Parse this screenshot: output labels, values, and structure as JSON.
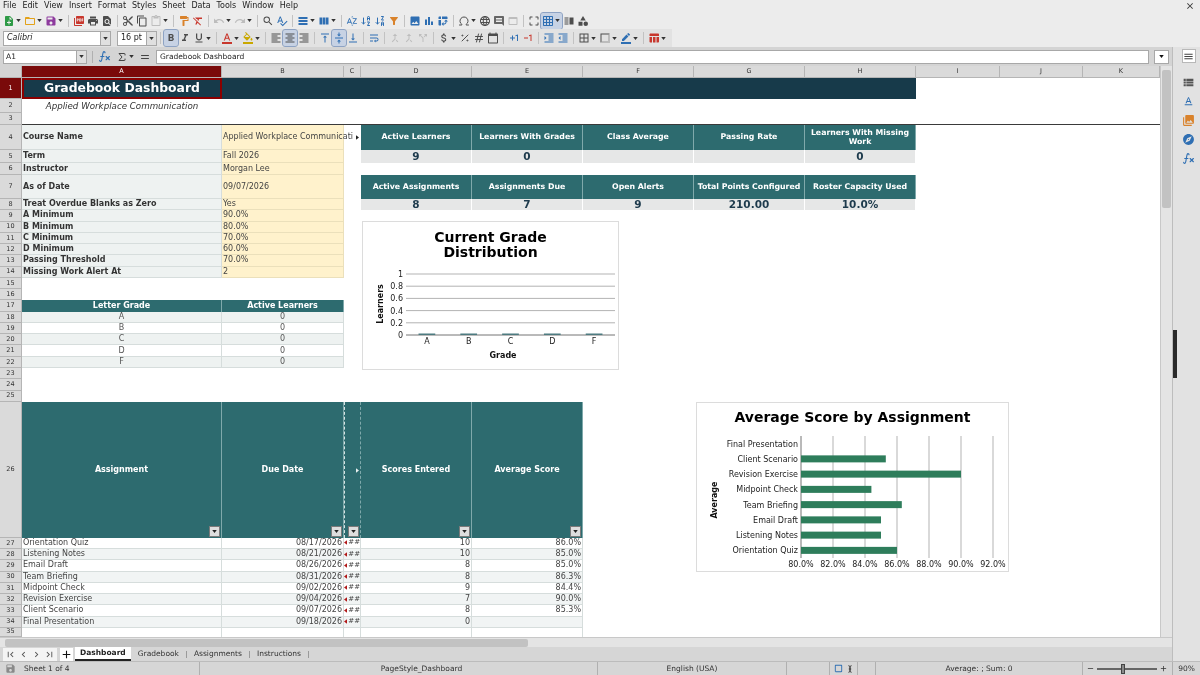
{
  "menu_bar": [
    "File",
    "Edit",
    "View",
    "Insert",
    "Format",
    "Styles",
    "Sheet",
    "Data",
    "Tools",
    "Window",
    "Help"
  ],
  "standard_toolbar": {
    "paste": {
      "disabled": true
    },
    "undo": {
      "disabled": true
    },
    "redo": {
      "disabled": true
    },
    "headers_footers": {
      "disabled": true
    },
    "freeze_rows_columns": {
      "on": true
    }
  },
  "formatting_toolbar": {
    "font_name": "Calibri",
    "font_size": "16 pt",
    "bold": {
      "on": true
    },
    "italic": {
      "on": false
    },
    "underline": {
      "on": false
    },
    "align_left": {
      "on": false
    },
    "align_center": {
      "on": true
    },
    "align_right": {
      "on": false
    },
    "align_top": {
      "on": false
    },
    "align_middle": {
      "on": true
    },
    "align_bottom": {
      "on": false
    },
    "merge_and_center": {
      "disabled": true
    },
    "merge_cells": {
      "disabled": true
    },
    "unmerge_cells": {
      "disabled": true
    }
  },
  "formula_bar": {
    "name_box": "A1",
    "content": "Gradebook Dashboard"
  },
  "column_headers": [
    {
      "label": "A",
      "selected": true
    },
    {
      "label": "B",
      "selected": false
    },
    {
      "label": "C",
      "selected": false
    },
    {
      "label": "D",
      "selected": false
    },
    {
      "label": "E",
      "selected": false
    },
    {
      "label": "F",
      "selected": false
    },
    {
      "label": "G",
      "selected": false
    },
    {
      "label": "H",
      "selected": false
    },
    {
      "label": "I",
      "selected": false
    },
    {
      "label": "J",
      "selected": false
    },
    {
      "label": "K",
      "selected": false
    }
  ],
  "row_headers": [
    {
      "label": "1",
      "selected": true
    },
    {
      "label": "2",
      "selected": false
    },
    {
      "label": "3",
      "selected": false
    },
    {
      "label": "4",
      "selected": false
    },
    {
      "label": "5",
      "selected": false
    },
    {
      "label": "6",
      "selected": false
    },
    {
      "label": "7",
      "selected": false
    },
    {
      "label": "8",
      "selected": false
    },
    {
      "label": "9",
      "selected": false
    },
    {
      "label": "10",
      "selected": false
    },
    {
      "label": "11",
      "selected": false
    },
    {
      "label": "12",
      "selected": false
    },
    {
      "label": "13",
      "selected": false
    },
    {
      "label": "14",
      "selected": false
    },
    {
      "label": "15",
      "selected": false
    },
    {
      "label": "16",
      "selected": false
    },
    {
      "label": "17",
      "selected": false
    },
    {
      "label": "18",
      "selected": false
    },
    {
      "label": "19",
      "selected": false
    },
    {
      "label": "20",
      "selected": false
    },
    {
      "label": "21",
      "selected": false
    },
    {
      "label": "22",
      "selected": false
    },
    {
      "label": "23",
      "selected": false
    },
    {
      "label": "24",
      "selected": false
    },
    {
      "label": "25",
      "selected": false
    },
    {
      "label": "26",
      "selected": false
    },
    {
      "label": "27",
      "selected": false
    },
    {
      "label": "28",
      "selected": false
    },
    {
      "label": "29",
      "selected": false
    },
    {
      "label": "30",
      "selected": false
    },
    {
      "label": "31",
      "selected": false
    },
    {
      "label": "32",
      "selected": false
    },
    {
      "label": "33",
      "selected": false
    },
    {
      "label": "34",
      "selected": false
    },
    {
      "label": "35",
      "selected": false
    }
  ],
  "title": "Gradebook Dashboard",
  "subtitle": "Applied Workplace Communication",
  "course_settings": [
    {
      "label": "Course Name",
      "value": "Applied Workplace Communicati",
      "clipped": true
    },
    {
      "label": "Term",
      "value": "Fall 2026",
      "clipped": false
    },
    {
      "label": "Instructor",
      "value": "Morgan Lee",
      "clipped": false
    },
    {
      "label": "As of Date",
      "value": "09/07/2026",
      "clipped": false
    },
    {
      "label": "Treat Overdue Blanks as Zero",
      "value": "Yes",
      "clipped": false
    },
    {
      "label": "A Minimum",
      "value": "90.0%",
      "clipped": false
    },
    {
      "label": "B Minimum",
      "value": "80.0%",
      "clipped": false
    },
    {
      "label": "C Minimum",
      "value": "70.0%",
      "clipped": false
    },
    {
      "label": "D Minimum",
      "value": "60.0%",
      "clipped": false
    },
    {
      "label": "Passing Threshold",
      "value": "70.0%",
      "clipped": false
    },
    {
      "label": "Missing Work Alert At",
      "value": "2",
      "clipped": false
    }
  ],
  "kpi_tables": [
    [
      {
        "label": "Active Learners",
        "value": "9"
      },
      {
        "label": "Learners With Grades",
        "value": "0"
      },
      {
        "label": "Class Average"
      },
      {
        "label": "Passing Rate"
      },
      {
        "label": "Learners With Missing Work",
        "value": "0"
      }
    ],
    [
      {
        "label": "Active Assignments",
        "value": "8"
      },
      {
        "label": "Assignments Due",
        "value": "7"
      },
      {
        "label": "Open Alerts",
        "value": "9"
      },
      {
        "label": "Total Points Configured",
        "value": "210.00"
      },
      {
        "label": "Roster Capacity Used",
        "value": "10.0%"
      }
    ]
  ],
  "grade_table": {
    "columns": [
      "Letter Grade",
      "Active Learners"
    ],
    "rows": [
      {
        "grade": "A",
        "count": "0"
      },
      {
        "grade": "B",
        "count": "0"
      },
      {
        "grade": "C",
        "count": "0"
      },
      {
        "grade": "D",
        "count": "0"
      },
      {
        "grade": "F",
        "count": "0"
      }
    ]
  },
  "assignments_table": {
    "columns": [
      {
        "label": "Assignment"
      },
      {
        "label": "Due Date"
      },
      {
        "clipped": true
      },
      {
        "label": "Scores Entered"
      },
      {
        "label": "Average Score"
      }
    ],
    "rows": [
      {
        "assignment": "Orientation Quiz",
        "due_date": "08/17/2026",
        "column_3": "##",
        "clipped": true,
        "scores_entered": "10",
        "average_score": "86.0%"
      },
      {
        "assignment": "Listening Notes",
        "due_date": "08/21/2026",
        "column_3": "##",
        "clipped": true,
        "scores_entered": "10",
        "average_score": "85.0%"
      },
      {
        "assignment": "Email Draft",
        "due_date": "08/26/2026",
        "column_3": "##",
        "clipped": true,
        "scores_entered": "8",
        "average_score": "85.0%"
      },
      {
        "assignment": "Team Briefing",
        "due_date": "08/31/2026",
        "column_3": "##",
        "clipped": true,
        "scores_entered": "8",
        "average_score": "86.3%"
      },
      {
        "assignment": "Midpoint Check",
        "due_date": "09/02/2026",
        "column_3": "##",
        "clipped": true,
        "scores_entered": "9",
        "average_score": "84.4%"
      },
      {
        "assignment": "Revision Exercise",
        "due_date": "09/04/2026",
        "column_3": "##",
        "clipped": true,
        "scores_entered": "7",
        "average_score": "90.0%"
      },
      {
        "assignment": "Client Scenario",
        "due_date": "09/07/2026",
        "column_3": "##",
        "clipped": true,
        "scores_entered": "8",
        "average_score": "85.3%"
      },
      {
        "assignment": "Final Presentation",
        "due_date": "09/18/2026",
        "column_3": "##",
        "clipped": true,
        "scores_entered": "0"
      }
    ]
  },
  "grade_chart": {
    "chart_data": {
      "type": "bar",
      "title": "Current Grade Distribution",
      "xlabel": "Grade",
      "ylabel": "Learners",
      "categories": [
        "A",
        "B",
        "C",
        "D",
        "F"
      ],
      "values": [
        0,
        0,
        0,
        0,
        0
      ],
      "ylim": [
        0,
        1
      ],
      "yticks": [
        0,
        0.2,
        0.4,
        0.6,
        0.8,
        1
      ],
      "grid": true
    }
  },
  "score_chart": {
    "chart_data": {
      "type": "bar",
      "orientation": "horizontal",
      "title": "Average Score by Assignment",
      "ylabel": "Average",
      "categories": [
        "Final Presentation",
        "Client Scenario",
        "Revision Exercise",
        "Midpoint Check",
        "Team Briefing",
        "Email Draft",
        "Listening Notes",
        "Orientation Quiz"
      ],
      "values": [
        null,
        85.3,
        90.0,
        84.4,
        86.3,
        85.0,
        85.0,
        86.0
      ],
      "xlim": [
        80,
        92
      ],
      "xticks": [
        {
          "value": 80,
          "label": "80.0%"
        },
        {
          "value": 82,
          "label": "82.0%"
        },
        {
          "value": 84,
          "label": "84.0%"
        },
        {
          "value": 86,
          "label": "86.0%"
        },
        {
          "value": 88,
          "label": "88.0%"
        },
        {
          "value": 90,
          "label": "90.0%"
        },
        {
          "value": 92,
          "label": "92.0%"
        }
      ],
      "grid": true
    }
  },
  "sheet_tabs": [
    {
      "label": "Dashboard",
      "selected": true
    },
    {
      "label": "Gradebook",
      "selected": false
    },
    {
      "label": "Assignments",
      "selected": false
    },
    {
      "label": "Instructions",
      "selected": false
    }
  ],
  "status_bar": {
    "sheet": "Sheet 1 of 4",
    "page_style": "PageStyle_Dashboard",
    "language": "English (USA)",
    "selection_summary": "Average: ; Sum: 0",
    "zoom": {
      "level": 0.43
    },
    "zoom_reading": "90%"
  }
}
